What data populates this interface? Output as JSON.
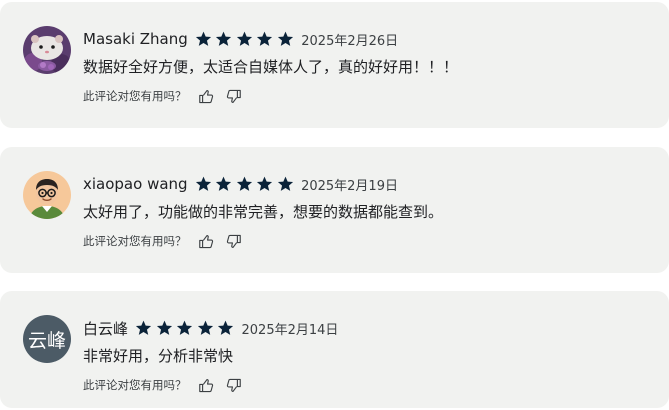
{
  "reviews": [
    {
      "name": "Masaki Zhang",
      "rating": 5,
      "date": "2025年2月26日",
      "text": "数据好全好方便，太适合自媒体人了，真的好好用！！！",
      "helpful_question": "此评论对您有用吗？",
      "avatar_icon": "hamster-photo"
    },
    {
      "name": "xiaopao wang",
      "rating": 5,
      "date": "2025年2月19日",
      "text": "太好用了，功能做的非常完善，想要的数据都能查到。",
      "helpful_question": "此评论对您有用吗？",
      "avatar_icon": "cartoon-man-glasses"
    },
    {
      "name": "白云峰",
      "rating": 5,
      "date": "2025年2月14日",
      "text": "非常好用，分析非常快",
      "helpful_question": "此评论对您有用吗？",
      "avatar_text": "云峰",
      "avatar_color": "#4c5b66"
    }
  ],
  "colors": {
    "card_background": "#f1f2f0",
    "star_color": "#0b2339"
  }
}
